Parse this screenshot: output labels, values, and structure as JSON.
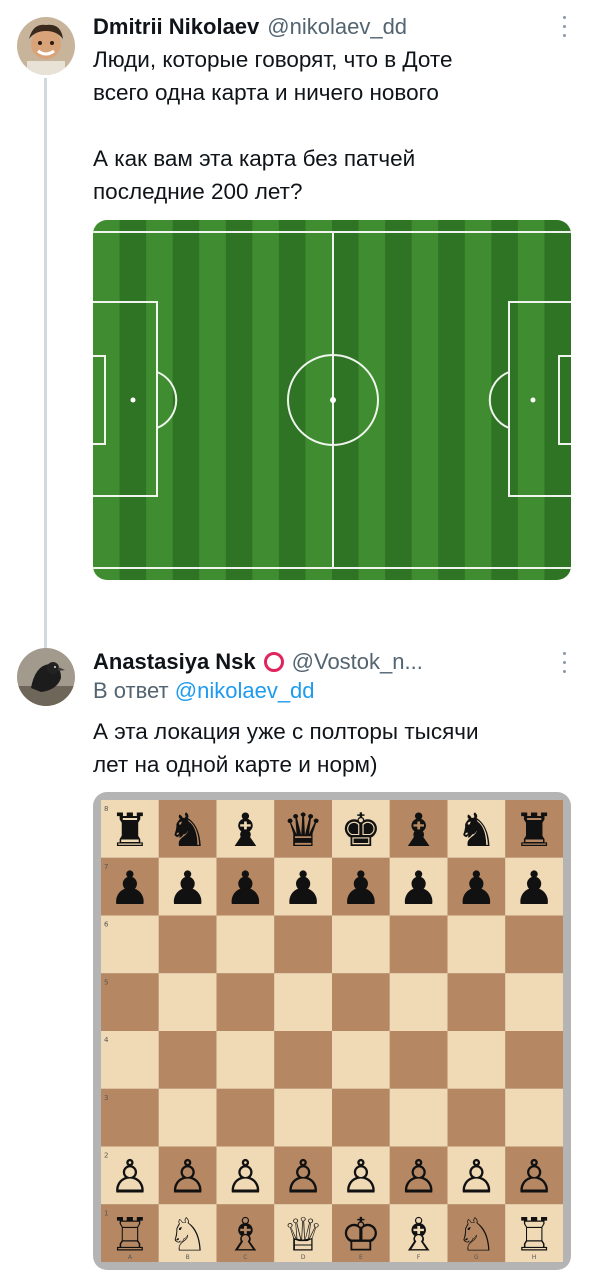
{
  "tweets": [
    {
      "author": "Dmitrii Nikolaev",
      "handle": "@nikolaev_dd",
      "text": [
        "Люди, которые говорят, что в Доте",
        "всего одна карта и ничего нового",
        "",
        "А как вам эта карта без патчей",
        "последние 200 лет?"
      ]
    },
    {
      "author": "Anastasiya Nsk",
      "handle": "@Vostok_n...",
      "reply_prefix": "В ответ",
      "reply_to": "@nikolaev_dd",
      "text": [
        "А эта локация уже с полторы тысячи",
        "лет на одной карте и норм)"
      ]
    }
  ],
  "colors": {
    "grass_light": "#3f8d30",
    "grass_dark": "#2f7424",
    "board_light": "#f0d9b5",
    "board_dark": "#b58863",
    "badge": "#e0245e",
    "link": "#1d9bf0"
  },
  "chess": {
    "ranks": [
      "8",
      "7",
      "6",
      "5",
      "4",
      "3",
      "2",
      "1"
    ],
    "files": [
      "A",
      "B",
      "C",
      "D",
      "E",
      "F",
      "G",
      "H"
    ],
    "back_black": [
      "♜",
      "♞",
      "♝",
      "♛",
      "♚",
      "♝",
      "♞",
      "♜"
    ],
    "pawn_black": "♟",
    "back_white": [
      "♖",
      "♘",
      "♗",
      "♕",
      "♔",
      "♗",
      "♘",
      "♖"
    ],
    "pawn_white": "♙"
  }
}
